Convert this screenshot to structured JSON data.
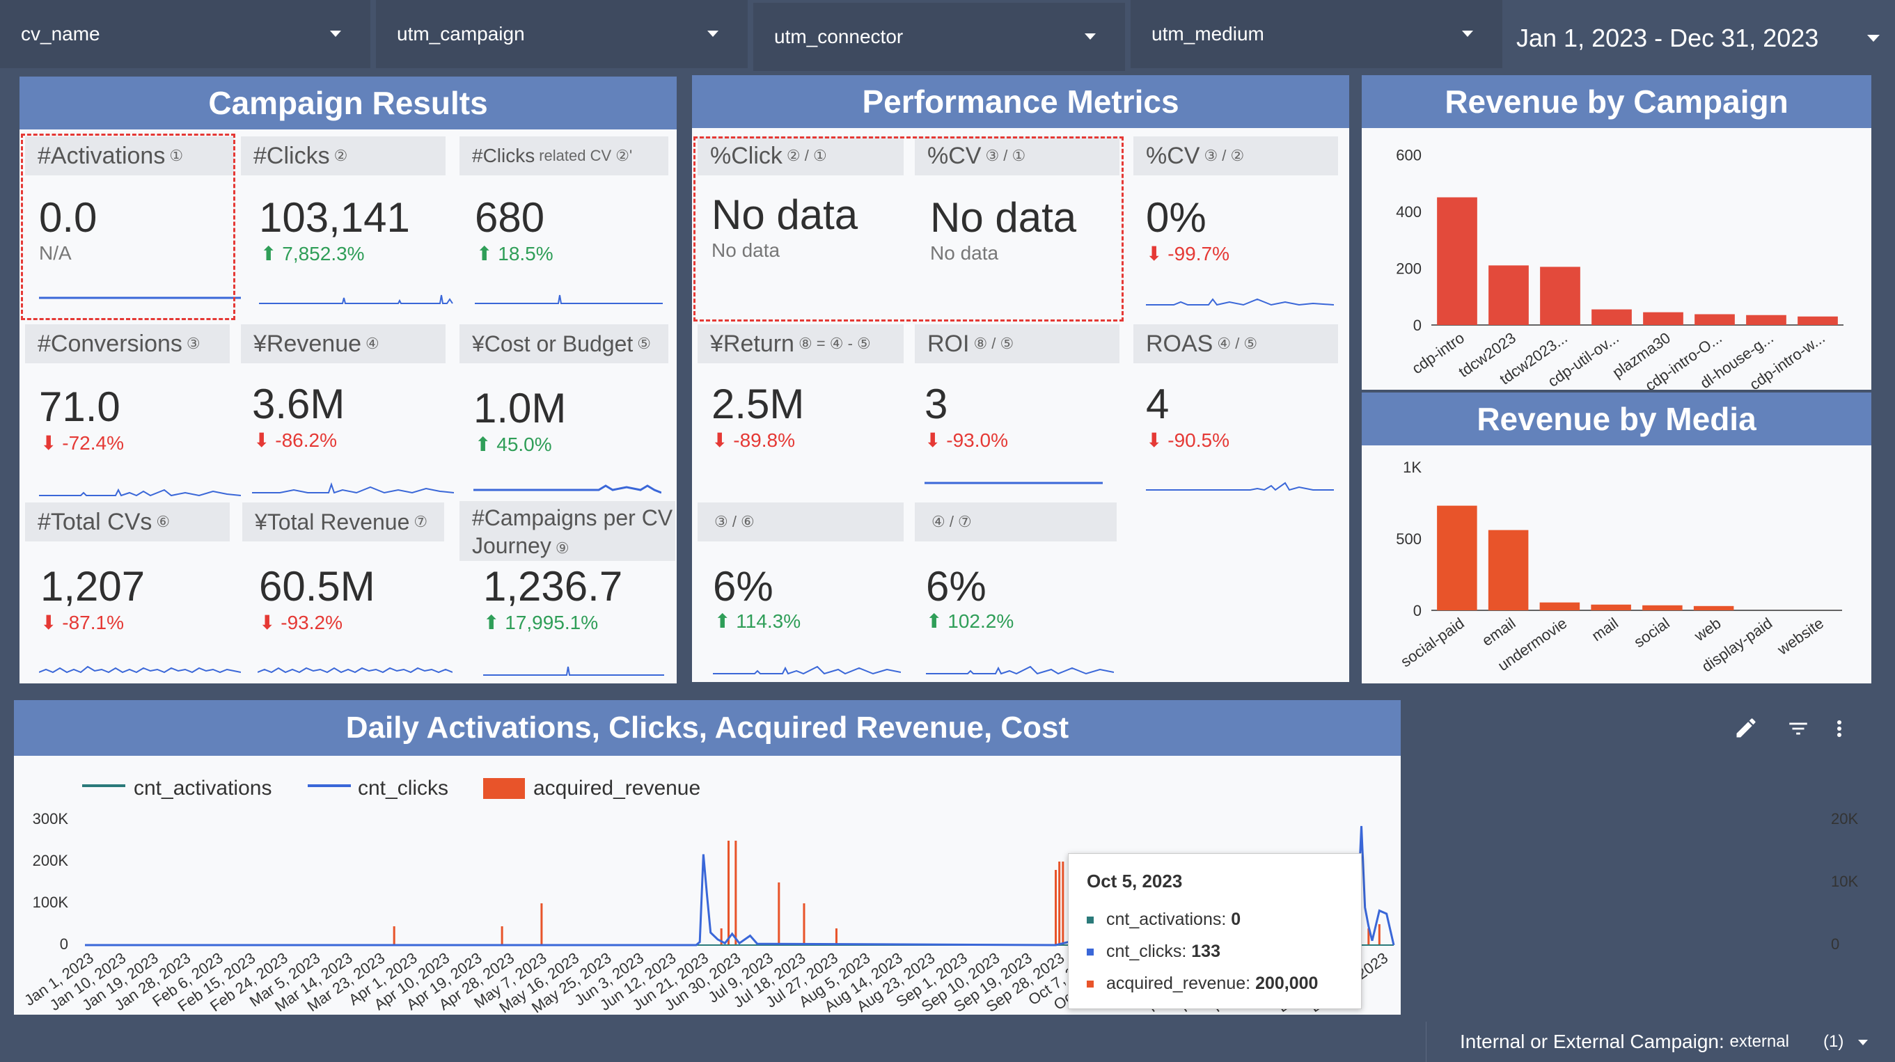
{
  "filters": [
    {
      "label": "cv_name"
    },
    {
      "label": "utm_campaign"
    },
    {
      "label": "utm_connector"
    },
    {
      "label": "utm_medium"
    }
  ],
  "date_range": "Jan 1, 2023 - Dec 31, 2023",
  "campaign_results": {
    "title": "Campaign Results",
    "tiles": [
      {
        "label": "#Activations",
        "sub": "①",
        "value": "0.0",
        "delta": "N/A",
        "dir": "na"
      },
      {
        "label": "#Clicks",
        "sub": "②",
        "value": "103,141",
        "delta": "7,852.3%",
        "dir": "up"
      },
      {
        "label": "#Clicks",
        "sub": "related CV ②'",
        "value": "680",
        "delta": "18.5%",
        "dir": "up"
      },
      {
        "label": "#Conversions",
        "sub": "③",
        "value": "71.0",
        "delta": "-72.4%",
        "dir": "down"
      },
      {
        "label": "¥Revenue",
        "sub": "④",
        "value": "3.6M",
        "delta": "-86.2%",
        "dir": "down"
      },
      {
        "label": "¥Cost or Budget",
        "sub": "⑤",
        "value": "1.0M",
        "delta": "45.0%",
        "dir": "up"
      },
      {
        "label": "#Total CVs",
        "sub": "⑥",
        "value": "1,207",
        "delta": "-87.1%",
        "dir": "down"
      },
      {
        "label": "¥Total Revenue",
        "sub": "⑦",
        "value": "60.5M",
        "delta": "-93.2%",
        "dir": "down"
      },
      {
        "label": "#Campaigns per CV Journey",
        "sub": "⑨",
        "value": "1,236.7",
        "delta": "17,995.1%",
        "dir": "up"
      }
    ]
  },
  "performance_metrics": {
    "title": "Performance Metrics",
    "tiles": [
      {
        "label": "%Click",
        "sub": "② / ①",
        "value": "No data",
        "delta": "No data",
        "dir": "na"
      },
      {
        "label": "%CV",
        "sub": "③ / ①",
        "value": "No data",
        "delta": "No data",
        "dir": "na"
      },
      {
        "label": "%CV",
        "sub": "③ / ②",
        "value": "0%",
        "delta": "-99.7%",
        "dir": "down"
      },
      {
        "label": "¥Return",
        "sub": "⑧ = ④ - ⑤",
        "value": "2.5M",
        "delta": "-89.8%",
        "dir": "down"
      },
      {
        "label": "ROI",
        "sub": "⑧ / ⑤",
        "value": "3",
        "delta": "-93.0%",
        "dir": "down"
      },
      {
        "label": "ROAS",
        "sub": "④ / ⑤",
        "value": "4",
        "delta": "-90.5%",
        "dir": "down"
      },
      {
        "label": "",
        "sub": "③ / ⑥",
        "value": "6%",
        "delta": "114.3%",
        "dir": "up"
      },
      {
        "label": "",
        "sub": "④ / ⑦",
        "value": "6%",
        "delta": "102.2%",
        "dir": "up"
      }
    ]
  },
  "revenue_by_campaign": {
    "title": "Revenue by Campaign"
  },
  "revenue_by_media": {
    "title": "Revenue by Media"
  },
  "daily": {
    "title": "Daily Activations, Clicks, Acquired Revenue, Cost",
    "legend": [
      "cnt_activations",
      "cnt_clicks",
      "acquired_revenue"
    ],
    "left_axis_ticks": [
      "0",
      "100K",
      "200K",
      "300K"
    ],
    "right_axis_ticks": [
      "0",
      "10K",
      "20K"
    ],
    "tooltip": {
      "date": "Oct 5, 2023",
      "rows": [
        {
          "name": "cnt_activations",
          "value": "0"
        },
        {
          "name": "cnt_clicks",
          "value": "133"
        },
        {
          "name": "acquired_revenue",
          "value": "200,000"
        }
      ]
    }
  },
  "bottom_filter": {
    "label": "Internal or External Campaign",
    "value": "external",
    "count": "(1)"
  },
  "colors": {
    "header_blue": "#6382bb",
    "bar_red": "#e34a3b",
    "bar_orange": "#e8542a",
    "line_blue": "#3a67d8",
    "line_teal": "#2b7a7a",
    "up_green": "#2f9e58",
    "down_red": "#e53935"
  },
  "chart_data": [
    {
      "type": "bar",
      "title": "Revenue by Campaign",
      "categories": [
        "cdp-intro",
        "tdcw2023",
        "tdcw2023...",
        "cdp-util-ov...",
        "plazma30",
        "cdp-intro-O...",
        "dl-house-g...",
        "cdp-intro-w..."
      ],
      "values": [
        450,
        210,
        205,
        55,
        45,
        38,
        35,
        30
      ],
      "ylim": [
        0,
        650
      ],
      "yticks": [
        0,
        200,
        400,
        600
      ],
      "grid": false
    },
    {
      "type": "bar",
      "title": "Revenue by Media",
      "categories": [
        "social-paid",
        "email",
        "undermovie",
        "mail",
        "social",
        "web",
        "display-paid",
        "website"
      ],
      "values": [
        730,
        560,
        55,
        40,
        35,
        30,
        0,
        0
      ],
      "ylim": [
        0,
        1000
      ],
      "yticks": [
        0,
        500,
        1000
      ],
      "ytick_labels": [
        "0",
        "500",
        "1K"
      ],
      "grid": false
    },
    {
      "type": "line",
      "title": "Daily Activations, Clicks, Acquired Revenue, Cost",
      "x_ticks": [
        "Jan 1, 2023",
        "Jan 10, 2023",
        "Jan 19, 2023",
        "Jan 28, 2023",
        "Feb 6, 2023",
        "Feb 15, 2023",
        "Feb 24, 2023",
        "Mar 5, 2023",
        "Mar 14, 2023",
        "Mar 23, 2023",
        "Apr 1, 2023",
        "Apr 10, 2023",
        "Apr 19, 2023",
        "Apr 28, 2023",
        "May 7, 2023",
        "May 16, 2023",
        "May 25, 2023",
        "Jun 3, 2023",
        "Jun 12, 2023",
        "Jun 21, 2023",
        "Jun 30, 2023",
        "Jul 9, 2023",
        "Jul 18, 2023",
        "Jul 27, 2023",
        "Aug 5, 2023",
        "Aug 14, 2023",
        "Aug 23, 2023",
        "Sep 1, 2023",
        "Sep 10, 2023",
        "Sep 19, 2023",
        "Sep 28, 2023",
        "Oct 7, 2023",
        "Oct 16, 2023",
        "Oct 25, 2023",
        "Nov 3, 2023",
        "Nov 12, 2023",
        "Nov 21, 2023",
        "Nov 30, 2023",
        "Dec 9, 2023",
        "Dec 18, 2023",
        "Dec 27, 2023"
      ],
      "left_ylim": [
        0,
        300000
      ],
      "right_ylim": [
        0,
        20000
      ],
      "series": [
        {
          "name": "cnt_activations",
          "axis": "left",
          "points": [
            [
              0,
              0
            ],
            [
              364,
              0
            ]
          ]
        },
        {
          "name": "cnt_clicks",
          "axis": "right",
          "points": [
            [
              0,
              0
            ],
            [
              170,
              0
            ],
            [
              171,
              500
            ],
            [
              172,
              14500
            ],
            [
              173,
              8000
            ],
            [
              174,
              2000
            ],
            [
              176,
              900
            ],
            [
              178,
              300
            ],
            [
              180,
              1800
            ],
            [
              182,
              300
            ],
            [
              185,
              1500
            ],
            [
              187,
              200
            ],
            [
              190,
              200
            ],
            [
              270,
              0
            ],
            [
              275,
              700
            ],
            [
              277,
              133
            ],
            [
              280,
              0
            ],
            [
              290,
              200
            ],
            [
              300,
              100
            ],
            [
              315,
              500
            ],
            [
              330,
              300
            ],
            [
              345,
              800
            ],
            [
              350,
              600
            ],
            [
              354,
              6000
            ],
            [
              355,
              19000
            ],
            [
              356,
              6000
            ],
            [
              357,
              3000
            ],
            [
              358,
              700
            ],
            [
              360,
              5500
            ],
            [
              362,
              5000
            ],
            [
              364,
              0
            ]
          ]
        },
        {
          "name": "acquired_revenue",
          "axis": "left",
          "bars": [
            [
              86,
              45000
            ],
            [
              116,
              45000
            ],
            [
              127,
              100000
            ],
            [
              177,
              40000
            ],
            [
              179,
              250000
            ],
            [
              181,
              250000
            ],
            [
              193,
              150000
            ],
            [
              200,
              100000
            ],
            [
              209,
              40000
            ],
            [
              270,
              180000
            ],
            [
              271,
              200000
            ],
            [
              272,
              200000
            ],
            [
              277,
              200000
            ],
            [
              300,
              40000
            ],
            [
              315,
              50000
            ],
            [
              332,
              100000
            ],
            [
              350,
              100000
            ],
            [
              352,
              120000
            ],
            [
              353,
              150000
            ],
            [
              354,
              50000
            ],
            [
              357,
              40000
            ],
            [
              360,
              50000
            ]
          ]
        }
      ],
      "legend_position": "top-left"
    }
  ]
}
